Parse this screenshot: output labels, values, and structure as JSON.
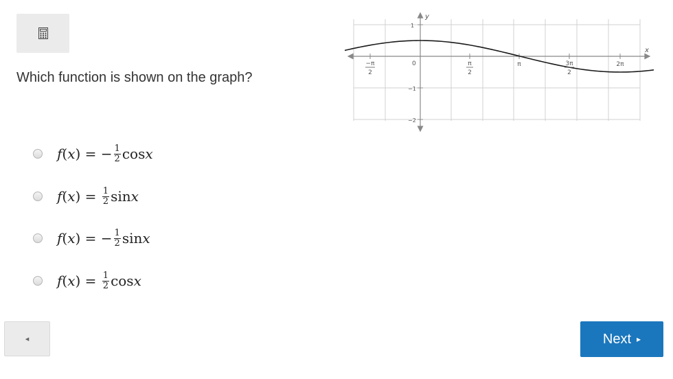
{
  "calculator": {
    "icon": "calculator-icon"
  },
  "question": {
    "text": "Which function is shown on the graph?"
  },
  "graph": {
    "axis_labels": {
      "x": "x",
      "y": "y"
    },
    "origin_label": "0",
    "y_ticks": [
      "1",
      "−1",
      "−2"
    ],
    "x_ticks": [
      {
        "num": "−π",
        "den": "2"
      },
      {
        "num": "π",
        "den": "2"
      },
      {
        "text": "π"
      },
      {
        "num": "3π",
        "den": "2"
      },
      {
        "text": "2π"
      }
    ],
    "curve": {
      "amplitude": 0.5,
      "function": "cos",
      "x_min_rad": -2.0,
      "x_max_rad": 6.8
    }
  },
  "choices": [
    {
      "prefix": "f",
      "var": "x",
      "sign": "−",
      "num": "1",
      "den": "2",
      "fn": "cos"
    },
    {
      "prefix": "f",
      "var": "x",
      "sign": "",
      "num": "1",
      "den": "2",
      "fn": "sin"
    },
    {
      "prefix": "f",
      "var": "x",
      "sign": "−",
      "num": "1",
      "den": "2",
      "fn": "sin"
    },
    {
      "prefix": "f",
      "var": "x",
      "sign": "",
      "num": "1",
      "den": "2",
      "fn": "cos"
    }
  ],
  "nav": {
    "prev_symbol": "◂",
    "next_label": "Next",
    "next_symbol": "▸"
  }
}
